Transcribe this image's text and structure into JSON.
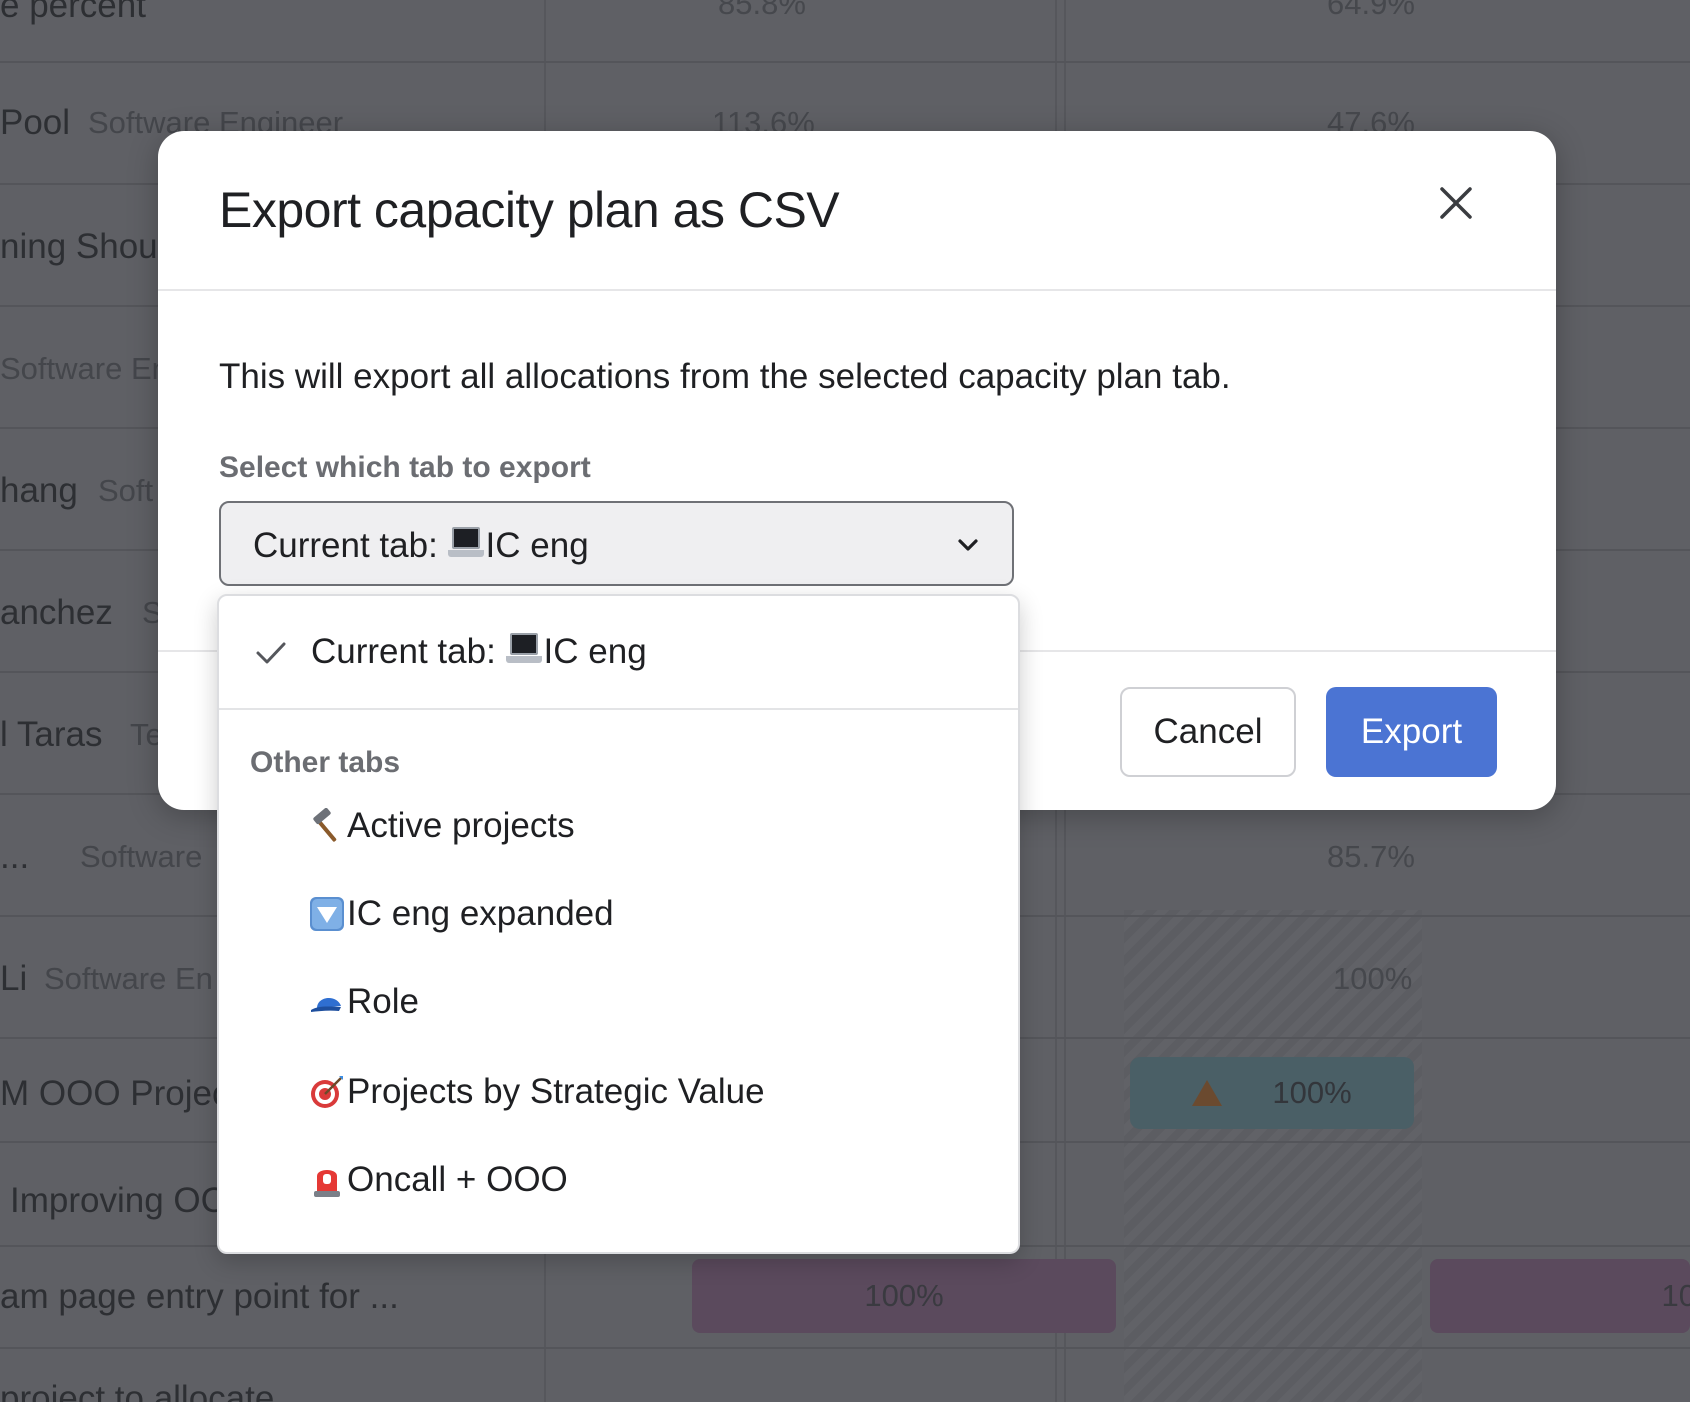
{
  "background": {
    "header_row": {
      "name": "e percent",
      "values": [
        "85.8%",
        "64.9%"
      ]
    },
    "rows": [
      {
        "name": "Pool",
        "role": "Software Engineer",
        "values": [
          "113.6%",
          "47.6%"
        ]
      },
      {
        "name": "ning Shou",
        "role": "",
        "values": []
      },
      {
        "name": "",
        "role": "Software En",
        "values": []
      },
      {
        "name": "hang",
        "role": "Soft",
        "values": []
      },
      {
        "name": "anchez",
        "role": "S",
        "values": []
      },
      {
        "name": "l Taras",
        "role": "Te",
        "values": []
      },
      {
        "name": "...",
        "role": "Software",
        "values": [
          "85.7%"
        ]
      },
      {
        "name": "Li",
        "role": "Software En",
        "values": [
          "100%"
        ]
      },
      {
        "name": "M OOO Projec",
        "role": "",
        "values": [
          "100%"
        ]
      },
      {
        "name": "Improving OC",
        "role": "",
        "values": []
      },
      {
        "name": "am page entry point for ...",
        "role": "",
        "values": [
          "100%",
          "10"
        ]
      },
      {
        "name": "project to allocate",
        "role": "",
        "values": []
      }
    ]
  },
  "modal": {
    "title": "Export capacity plan as CSV",
    "description": "This will export all allocations from the selected capacity plan tab.",
    "field_label": "Select which tab to export",
    "select": {
      "prefix": "Current tab: ",
      "icon": "laptop-icon",
      "value": "IC eng"
    },
    "cancel_label": "Cancel",
    "export_label": "Export",
    "accent_color": "#4b74d3"
  },
  "dropdown": {
    "selected": {
      "prefix": "Current tab: ",
      "icon": "laptop-icon",
      "label": "IC eng"
    },
    "group_label": "Other tabs",
    "items": [
      {
        "icon": "hammer-icon",
        "label": "Active projects"
      },
      {
        "icon": "down-arrow-button-icon",
        "label": "IC eng expanded"
      },
      {
        "icon": "billed-cap-icon",
        "label": " Role"
      },
      {
        "icon": "target-icon",
        "label": " Projects by Strategic Value"
      },
      {
        "icon": "police-light-icon",
        "label": "Oncall + OOO"
      }
    ]
  }
}
